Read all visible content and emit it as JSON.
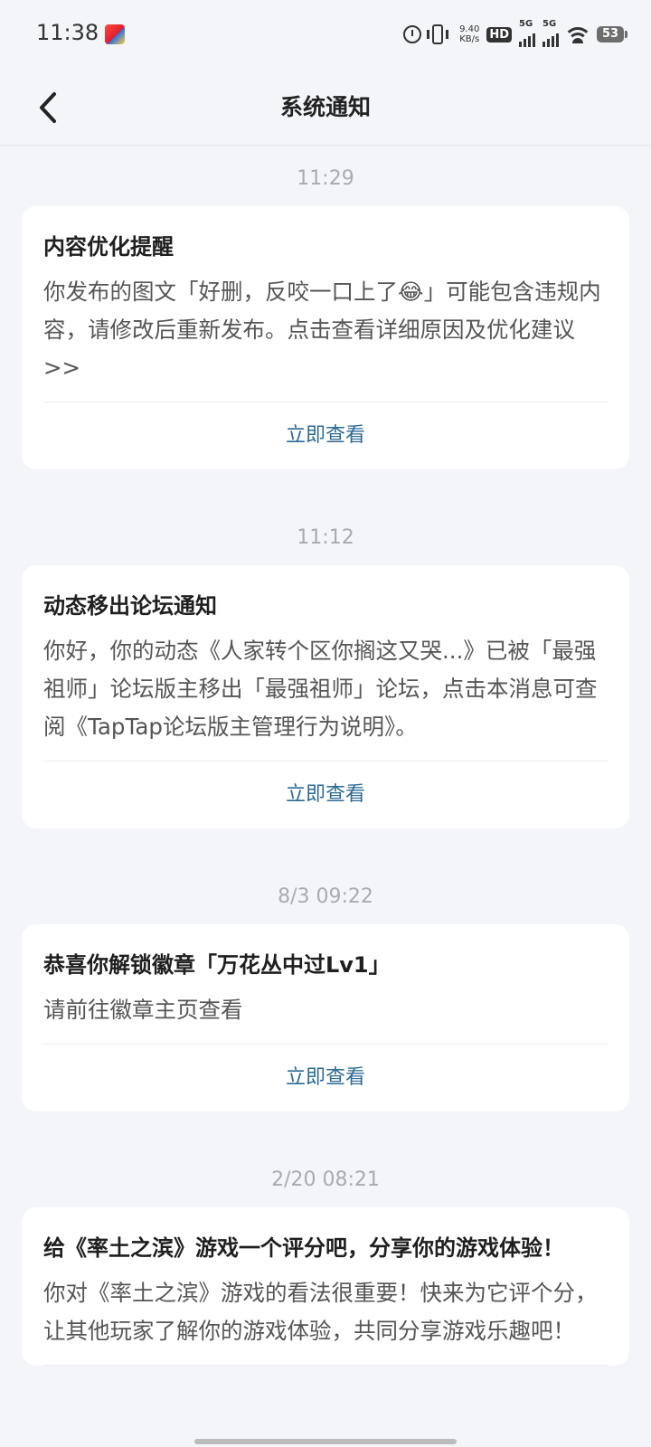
{
  "status_bar": {
    "time": "11:38",
    "net_speed_value": "9.40",
    "net_speed_unit": "KB/s",
    "hd_label": "HD",
    "sim1_label": "5G",
    "sim2_label": "5G",
    "battery": "53"
  },
  "header": {
    "title": "系统通知"
  },
  "notifications": [
    {
      "time": "11:29",
      "title": "内容优化提醒",
      "body": "你发布的图文「好删，反咬一口上了😂」可能包含违规内容，请修改后重新发布。点击查看详细原因及优化建议>>",
      "action": "立即查看"
    },
    {
      "time": "11:12",
      "title": "动态移出论坛通知",
      "body": "你好，你的动态《人家转个区你搁这又哭...》已被「最强祖师」论坛版主移出「最强祖师」论坛，点击本消息可查阅《TapTap论坛版主管理行为说明》。",
      "action": "立即查看"
    },
    {
      "time": "8/3  09:22",
      "title": "恭喜你解锁徽章「万花丛中过Lv1」",
      "body": "请前往徽章主页查看",
      "action": "立即查看"
    },
    {
      "time": "2/20  08:21",
      "title": "给《率土之滨》游戏一个评分吧，分享你的游戏体验！",
      "body": "你对《率土之滨》游戏的看法很重要！快来为它评个分，让其他玩家了解你的游戏体验，共同分享游戏乐趣吧！"
    }
  ],
  "colors": {
    "background": "#f3f5f8",
    "card": "#ffffff",
    "action_link": "#2c6a94",
    "timestamp": "#a8abb0"
  },
  "icons": [
    "back-arrow-icon",
    "alarm-icon",
    "vibrate-icon",
    "wifi-icon",
    "battery-icon"
  ]
}
